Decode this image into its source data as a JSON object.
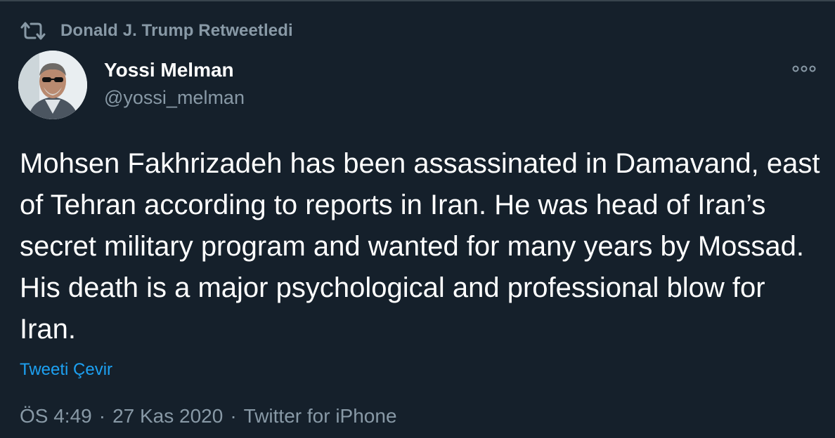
{
  "retweet": {
    "icon": "retweet-icon",
    "label": "Donald J. Trump Retweetledi"
  },
  "author": {
    "avatar_icon": "avatar",
    "display_name": "Yossi Melman",
    "handle": "@yossi_melman"
  },
  "more": {
    "icon": "more-options-icon"
  },
  "tweet": {
    "text": "Mohsen Fakhrizadeh has been assassinated in Damavand, east of Tehran according to reports in Iran. He was head of Iran’s secret military program and wanted for many years by Mossad. His death is a major psychological and professional blow for Iran.",
    "translate_label": "Tweeti Çevir"
  },
  "meta": {
    "time": "ÖS 4:49",
    "sep1": "·",
    "date": "27 Kas 2020",
    "sep2": "·",
    "source": "Twitter for iPhone"
  },
  "colors": {
    "background": "#15202b",
    "text_primary": "#ffffff",
    "text_secondary": "#8899a6",
    "link": "#1da1f2"
  }
}
